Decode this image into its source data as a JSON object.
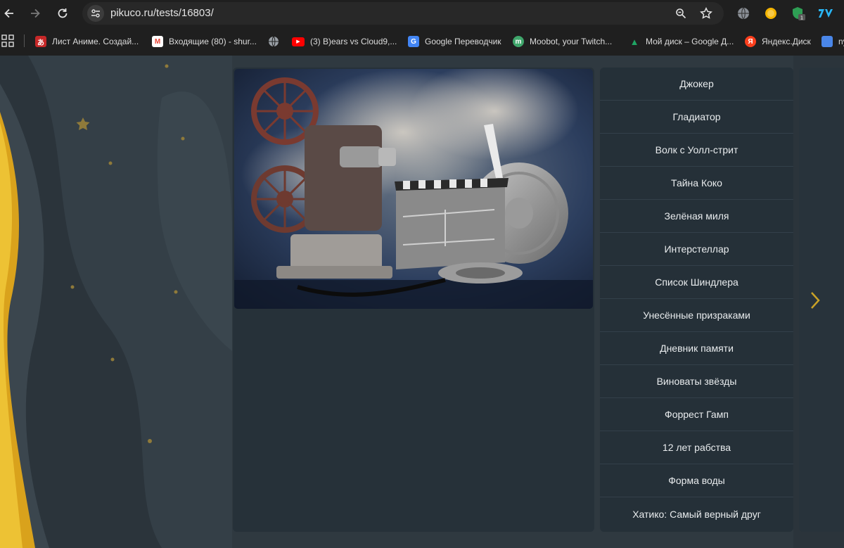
{
  "browser": {
    "url": "pikuco.ru/tests/16803/",
    "extension_badge": "1",
    "bookmarks": [
      {
        "label": "Лист Аниме. Создай...",
        "icon": "anime-icon",
        "color": "#c62828",
        "glyph": "あ"
      },
      {
        "label": "Входящие (80) - shur...",
        "icon": "gmail-icon",
        "color": "#ea4335",
        "glyph": "M"
      },
      {
        "label": "",
        "icon": "globe-icon",
        "color": "#9aa0a6",
        "glyph": ""
      },
      {
        "label": "(3) B)ears vs Cloud9,...",
        "icon": "youtube-icon",
        "color": "#ff0000",
        "glyph": "▶"
      },
      {
        "label": "Google Переводчик",
        "icon": "translate-icon",
        "color": "#4285f4",
        "glyph": "G"
      },
      {
        "label": "Moobot, your Twitch...",
        "icon": "moobot-icon",
        "color": "#3fa66b",
        "glyph": "m"
      },
      {
        "label": "Мой диск – Google Д...",
        "icon": "drive-icon",
        "color": "#1fa463",
        "glyph": "▲"
      },
      {
        "label": "Яндекс.Диск",
        "icon": "yandex-icon",
        "color": "#fc3f1d",
        "glyph": "Я"
      },
      {
        "label": "ny",
        "icon": "bookmark-icon",
        "color": "#4a86e8",
        "glyph": ""
      }
    ]
  },
  "movies": [
    "Джокер",
    "Гладиатор",
    "Волк с Уолл-стрит",
    "Тайна Коко",
    "Зелёная миля",
    "Интерстеллар",
    "Список Шиндлера",
    "Унесённые призраками",
    "Дневник памяти",
    "Виноваты звёзды",
    "Форрест Гамп",
    "12 лет рабства",
    "Форма воды",
    "Хатико: Самый верный друг"
  ],
  "colors": {
    "accent": "#e6b624",
    "page_bg": "#2f3940",
    "panel_bg": "#253038"
  }
}
